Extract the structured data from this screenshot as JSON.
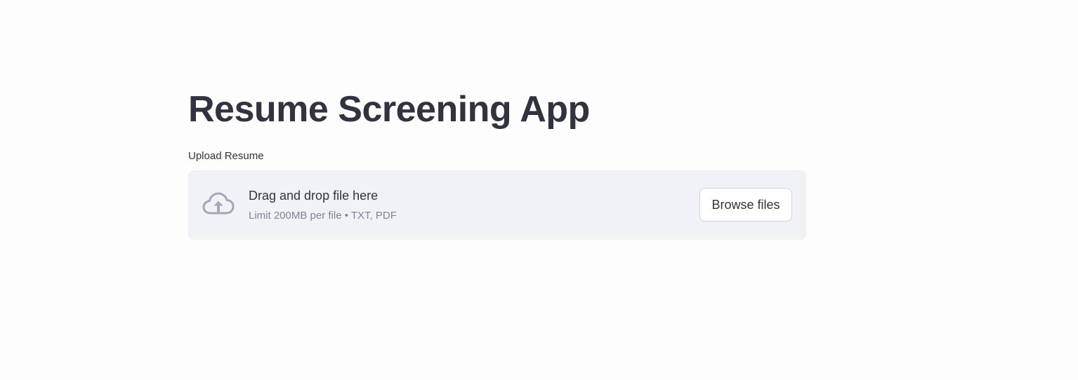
{
  "page": {
    "title": "Resume Screening App"
  },
  "uploader": {
    "label": "Upload Resume",
    "icon": "cloud-upload-icon",
    "instructions": "Drag and drop file here",
    "limits": "Limit 200MB per file • TXT, PDF",
    "browse_label": "Browse files"
  },
  "colors": {
    "text": "#31333f",
    "muted_text": "#808495",
    "dropzone_bg": "#f0f2f6",
    "icon": "#a3a8b8"
  }
}
